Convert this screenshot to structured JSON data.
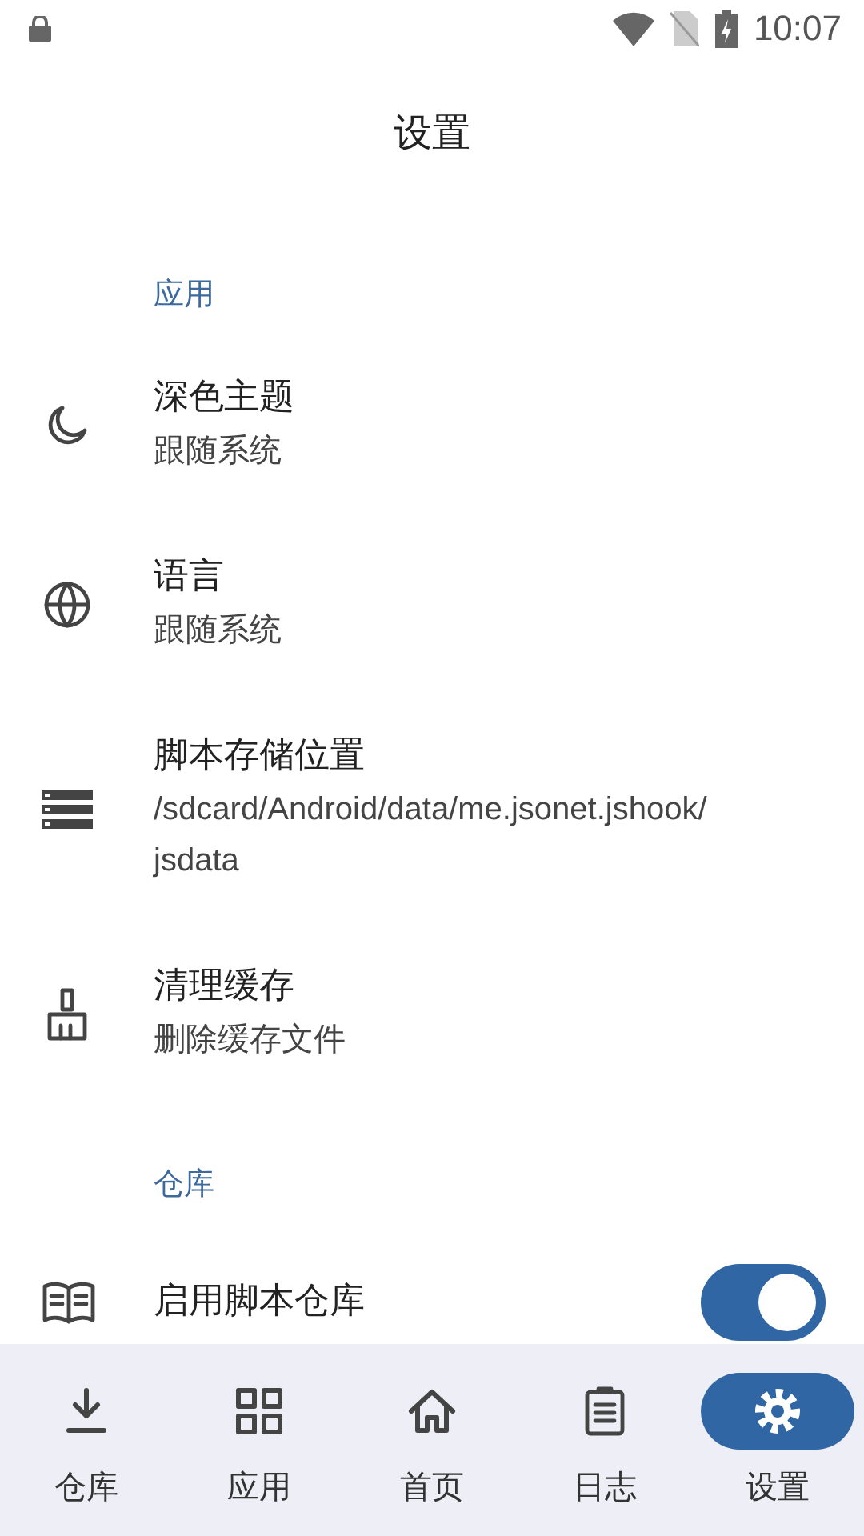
{
  "status_bar": {
    "time": "10:07"
  },
  "title": "设置",
  "sections": [
    {
      "header": "应用",
      "items": [
        {
          "kind": "plain",
          "title": "深色主题",
          "subtitle": "跟随系统"
        },
        {
          "kind": "plain",
          "title": "语言",
          "subtitle": "跟随系统"
        },
        {
          "kind": "plain",
          "title": "脚本存储位置",
          "subtitle": "/sdcard/Android/data/me.jsonet.jshook/\njsdata"
        },
        {
          "kind": "plain",
          "title": "清理缓存",
          "subtitle": "删除缓存文件"
        }
      ]
    },
    {
      "header": "仓库",
      "items": [
        {
          "kind": "switch",
          "title": "启用脚本仓库",
          "on": true
        }
      ]
    }
  ],
  "nav": [
    {
      "label": "仓库",
      "selected": false
    },
    {
      "label": "应用",
      "selected": false
    },
    {
      "label": "首页",
      "selected": false
    },
    {
      "label": "日志",
      "selected": false
    },
    {
      "label": "设置",
      "selected": true
    }
  ]
}
